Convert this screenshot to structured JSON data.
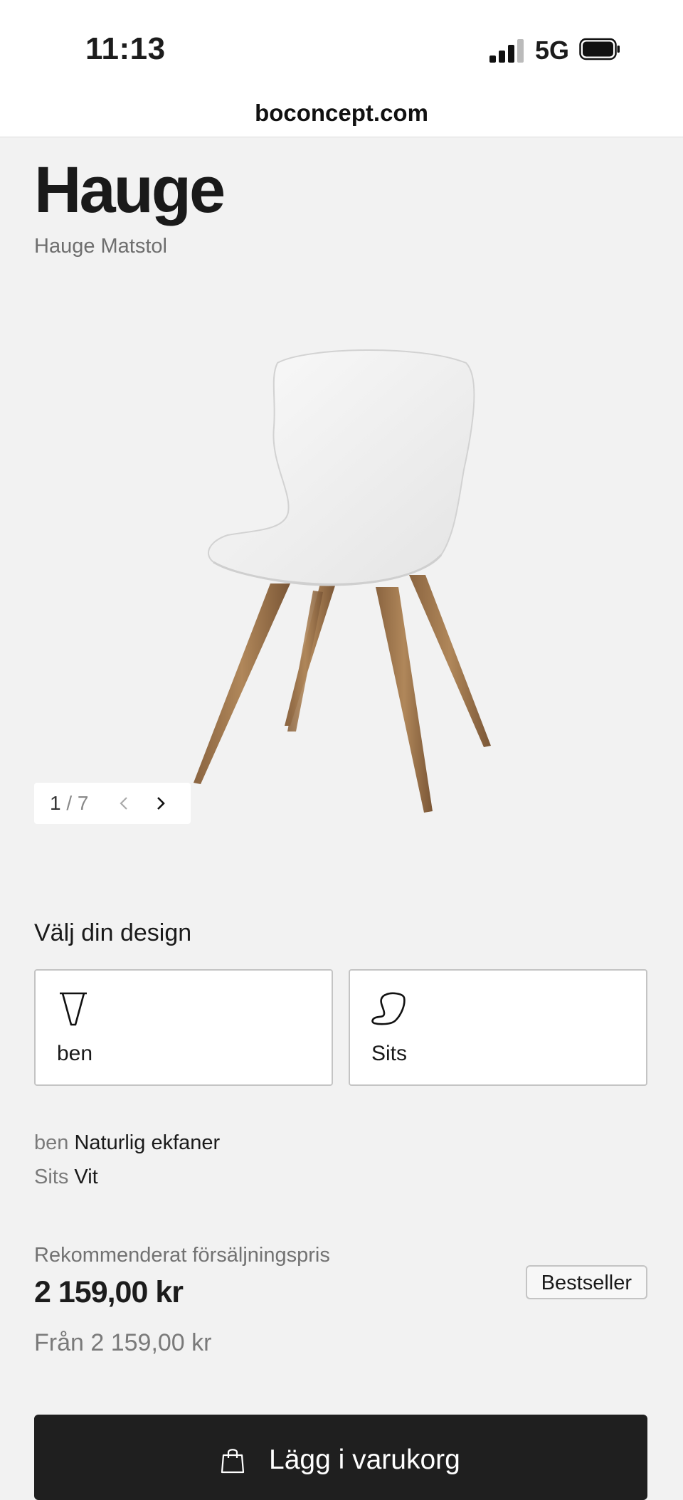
{
  "status_bar": {
    "time": "11:13",
    "network": "5G"
  },
  "browser": {
    "url": "boconcept.com"
  },
  "product": {
    "name": "Hauge",
    "subtitle": "Hauge Matstol"
  },
  "gallery": {
    "current": "1",
    "separator": " / ",
    "total": "7",
    "image_icon": "chair-image"
  },
  "design": {
    "heading": "Välj din design",
    "options": [
      {
        "label": "ben",
        "icon": "chair-leg-icon"
      },
      {
        "label": "Sits",
        "icon": "seat-shell-icon"
      }
    ],
    "selections": [
      {
        "key": "ben",
        "value": "Naturlig ekfaner"
      },
      {
        "key": "Sits",
        "value": "Vit"
      }
    ]
  },
  "pricing": {
    "caption": "Rekommenderat försäljningspris",
    "price": "2 159,00 kr",
    "from_price": "Från 2 159,00 kr",
    "badge": "Bestseller"
  },
  "cart": {
    "label": "Lägg i varukorg",
    "icon": "shopping-bag-icon"
  },
  "colors": {
    "background": "#f2f2f2",
    "button": "#1f1f1f",
    "button_text": "#ffffff"
  }
}
